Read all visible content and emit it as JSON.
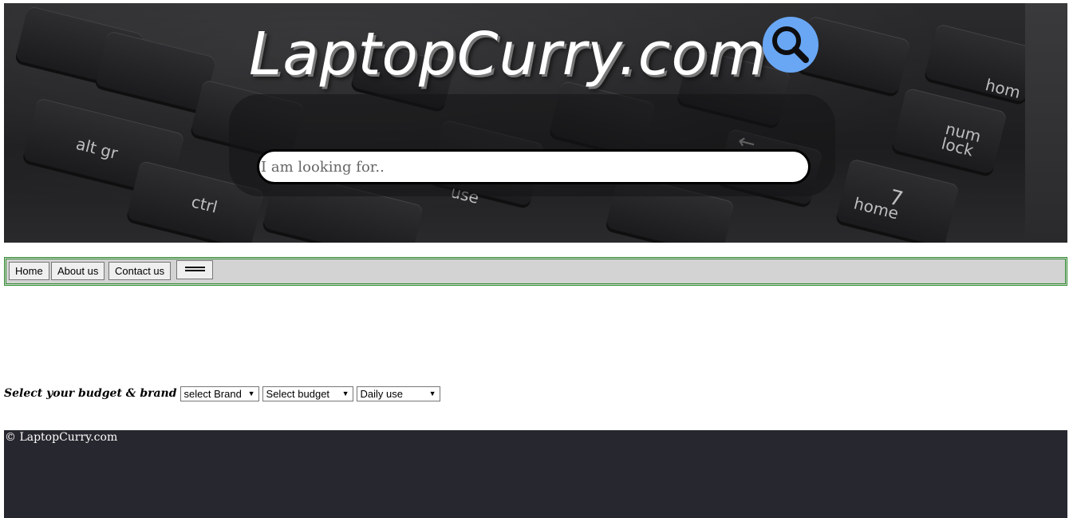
{
  "site": {
    "title": "LaptopCurry.com"
  },
  "hero": {
    "search_placeholder": "I am looking for.."
  },
  "nav": {
    "items": [
      {
        "label": "Home"
      },
      {
        "label": "About us"
      },
      {
        "label": "Contact us"
      }
    ]
  },
  "filters": {
    "label": "Select your budget & brand",
    "brand_select": "select Brand",
    "budget_select": "Select budget",
    "use_select": "Daily use"
  },
  "footer": {
    "copyright": "© LaptopCurry.com"
  },
  "colors": {
    "search_icon": "#69a7f5",
    "nav_border": "#2f8f2f",
    "nav_bg": "#d3d3d3",
    "footer_bg": "#27272f"
  }
}
